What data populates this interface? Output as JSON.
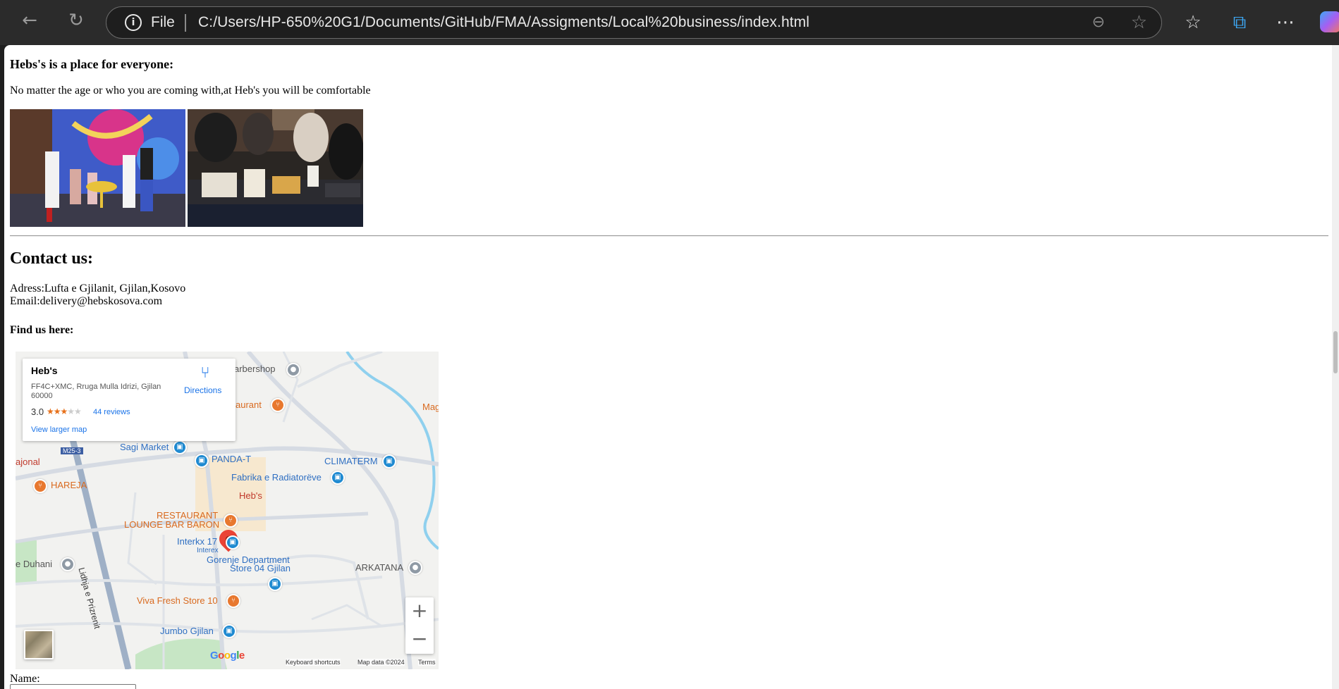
{
  "browser": {
    "site_info_label": "File",
    "url": "C:/Users/HP-650%20G1/Documents/GitHub/FMA/Assigments/Local%20business/index.html"
  },
  "page": {
    "everyone_heading": "Hebs's is a place for everyone:",
    "everyone_text": "No matter the age or who you are coming with,at Heb's you will be comfortable",
    "contact_heading": "Contact us:",
    "address_line": "Adress:Lufta e Gjilanit, Gjilan,Kosovo",
    "email_line": "Email:delivery@hebskosova.com",
    "find_us": "Find us here:",
    "name_label": "Name:"
  },
  "map": {
    "card": {
      "name": "Heb's",
      "address": "FF4C+XMC, Rruga Mulla Idrizi, Gjilan 60000",
      "rating": "3.0",
      "reviews": "44 reviews",
      "larger_map": "View larger map",
      "directions": "Directions"
    },
    "labels": {
      "barbershop": "arbershop",
      "restaurant_top": "aurant",
      "mag": "Mag",
      "sagi_market": "Sagi Market",
      "road_badge": "M25-3",
      "panda_t": "PANDA-T",
      "climaterm": "CLIMATERM",
      "ajonal": "ajonal",
      "hareja": "HAREJA",
      "fabrika": "Fabrika e Radiatorëve",
      "hebs_pin": "Heb's",
      "baron_1": "RESTAURANT",
      "baron_2": "LOUNGE BAR BARON",
      "duhani": "e Duhani",
      "interkx": "Interkx 17",
      "interex": "Interex",
      "gorenje_1": "Gorenje Department",
      "gorenje_2": "Store 04 Gjilan",
      "arkatana": "ARKATANA",
      "road_name": "Lidhja e Prizrenit",
      "viva": "Viva Fresh Store 10",
      "jumbo": "Jumbo Gjilan",
      "google": "Google",
      "keyboard": "Keyboard shortcuts",
      "mapdata": "Map data ©2024",
      "terms": "Terms"
    }
  }
}
